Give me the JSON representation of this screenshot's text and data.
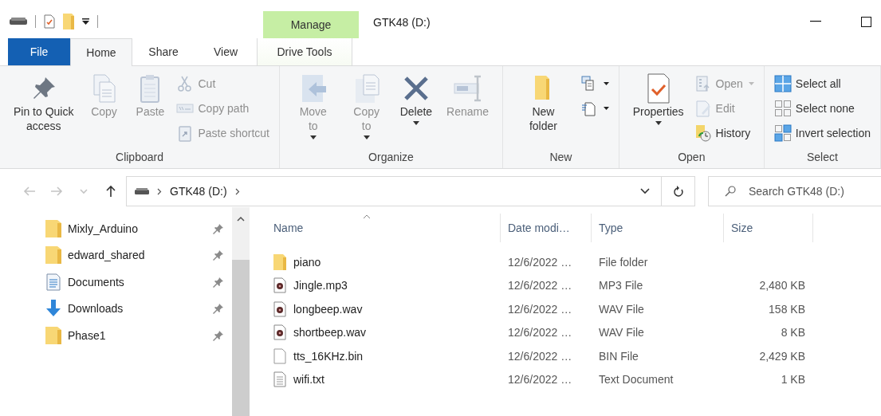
{
  "window": {
    "title": "GTK48 (D:)",
    "context_tab": "Manage"
  },
  "tabs": [
    {
      "label": "File",
      "kind": "file",
      "selected": false
    },
    {
      "label": "Home",
      "kind": "normal",
      "selected": true
    },
    {
      "label": "Share",
      "kind": "normal",
      "selected": false
    },
    {
      "label": "View",
      "kind": "normal",
      "selected": false
    },
    {
      "label": "Drive Tools",
      "kind": "context",
      "selected": false
    }
  ],
  "ribbon": [
    {
      "label": "Clipboard",
      "large": [
        {
          "label": "Pin to Quick access",
          "kind": "pin",
          "disabled": false,
          "dropdown": false
        },
        {
          "label": "Copy",
          "kind": "copy",
          "disabled": true,
          "dropdown": false
        },
        {
          "label": "Paste",
          "kind": "paste",
          "disabled": true,
          "dropdown": false
        }
      ],
      "small": [
        {
          "label": "Cut",
          "kind": "cut",
          "disabled": true,
          "dropdown": false
        },
        {
          "label": "Copy path",
          "kind": "copy-path",
          "disabled": true,
          "dropdown": false
        },
        {
          "label": "Paste shortcut",
          "kind": "paste-shortcut",
          "disabled": true,
          "dropdown": false
        }
      ]
    },
    {
      "label": "Organize",
      "large": [
        {
          "label": "Move to",
          "kind": "move",
          "disabled": true,
          "dropdown": true
        },
        {
          "label": "Copy to",
          "kind": "copy-to",
          "disabled": true,
          "dropdown": true
        },
        {
          "label": "Delete",
          "kind": "delete",
          "disabled": false,
          "dropdown": true
        },
        {
          "label": "Rename",
          "kind": "rename",
          "disabled": true,
          "dropdown": false
        }
      ]
    },
    {
      "label": "New",
      "large": [
        {
          "label": "New folder",
          "kind": "new-folder",
          "disabled": false,
          "dropdown": false
        }
      ],
      "small": [
        {
          "kind": "new-item",
          "disabled": false,
          "dropdown": true
        },
        {
          "kind": "easy-access",
          "disabled": false,
          "dropdown": true
        }
      ]
    },
    {
      "label": "Open",
      "large": [
        {
          "label": "Properties",
          "kind": "properties",
          "disabled": false,
          "dropdown": true
        }
      ],
      "small": [
        {
          "label": "Open",
          "kind": "open",
          "disabled": true,
          "dropdown": true
        },
        {
          "label": "Edit",
          "kind": "edit",
          "disabled": true,
          "dropdown": false
        },
        {
          "label": "History",
          "kind": "history",
          "disabled": false,
          "dropdown": false
        }
      ]
    },
    {
      "label": "Select",
      "small": [
        {
          "label": "Select all",
          "kind": "select-all",
          "disabled": false,
          "dropdown": false
        },
        {
          "label": "Select none",
          "kind": "select-none",
          "disabled": false,
          "dropdown": false
        },
        {
          "label": "Invert selection",
          "kind": "invert",
          "disabled": false,
          "dropdown": false
        }
      ]
    }
  ],
  "nav_buttons": [
    {
      "kind": "back",
      "disabled": true
    },
    {
      "kind": "forward",
      "disabled": true
    },
    {
      "kind": "recent",
      "disabled": true
    },
    {
      "kind": "up",
      "disabled": false
    }
  ],
  "address": {
    "crumbs": [
      "GTK48 (D:)"
    ]
  },
  "search": {
    "placeholder": "Search GTK48 (D:)"
  },
  "sidebar": {
    "items": [
      {
        "label": "Mixly_Arduino",
        "kind": "folder",
        "pinned": true
      },
      {
        "label": "edward_shared",
        "kind": "folder",
        "pinned": true
      },
      {
        "label": "Documents",
        "kind": "documents",
        "pinned": true
      },
      {
        "label": "Downloads",
        "kind": "downloads",
        "pinned": true
      },
      {
        "label": "Phase1",
        "kind": "folder",
        "pinned": true
      }
    ]
  },
  "table": {
    "columns": [
      {
        "label": "Name",
        "sorted": true
      },
      {
        "label": "Date modi…",
        "sorted": false
      },
      {
        "label": "Type",
        "sorted": false
      },
      {
        "label": "Size",
        "sorted": false
      }
    ],
    "rows": [
      {
        "name": "piano",
        "kind": "folder",
        "date": "12/6/2022 …",
        "type": "File folder"
      },
      {
        "name": "Jingle.mp3",
        "kind": "audio",
        "date": "12/6/2022 …",
        "type": "MP3 File",
        "size": "2,480 KB"
      },
      {
        "name": "longbeep.wav",
        "kind": "audio",
        "date": "12/6/2022 …",
        "type": "WAV File",
        "size": "158 KB"
      },
      {
        "name": "shortbeep.wav",
        "kind": "audio",
        "date": "12/6/2022 …",
        "type": "WAV File",
        "size": "8 KB"
      },
      {
        "name": "tts_16KHz.bin",
        "kind": "file",
        "date": "12/6/2022 …",
        "type": "BIN File",
        "size": "2,429 KB"
      },
      {
        "name": "wifi.txt",
        "kind": "text",
        "date": "12/6/2022 …",
        "type": "Text Document",
        "size": "1 KB"
      }
    ]
  }
}
